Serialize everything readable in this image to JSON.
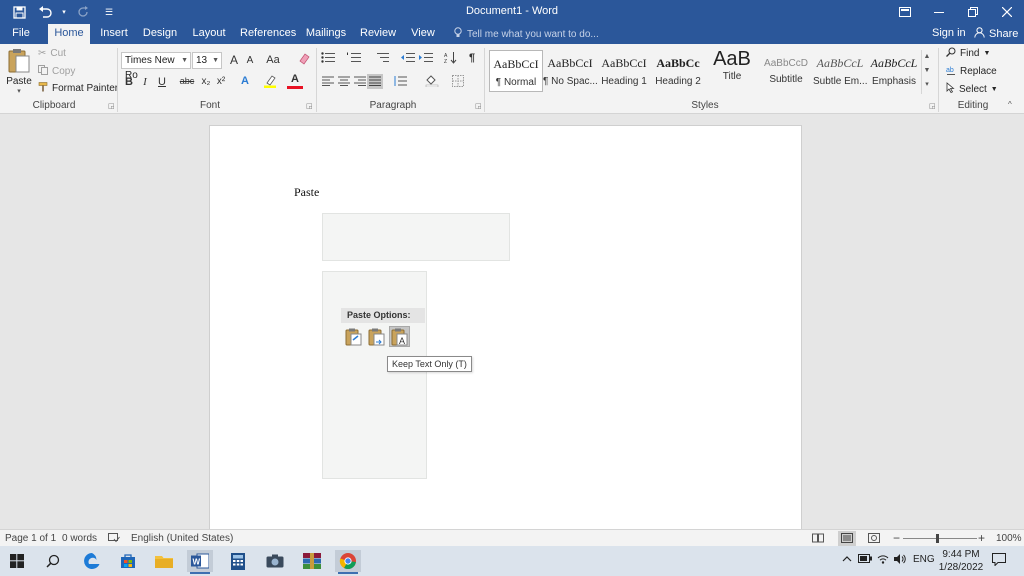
{
  "window": {
    "title": "Document1 - Word",
    "minimize_icon": "minimize-icon",
    "restore_icon": "restore-icon",
    "close_icon": "close-icon"
  },
  "tabs": [
    "File",
    "Home",
    "Insert",
    "Design",
    "Layout",
    "References",
    "Mailings",
    "Review",
    "View"
  ],
  "active_tab": "Home",
  "tell_me": "Tell me what you want to do...",
  "sign_in": "Sign in",
  "share": "Share",
  "clipboard": {
    "paste": "Paste",
    "cut": "Cut",
    "copy": "Copy",
    "format_painter": "Format Painter",
    "group": "Clipboard"
  },
  "font": {
    "name": "Times New Ro",
    "size": "13",
    "group": "Font",
    "grow": "A",
    "shrink": "A",
    "case": "Aa",
    "bold": "B",
    "italic": "I",
    "underline": "U",
    "strike": "abc",
    "subscript": "x₂",
    "superscript": "x²",
    "effects": "A",
    "font_color": "A"
  },
  "paragraph": {
    "group": "Paragraph",
    "pilcrow": "¶"
  },
  "styles": {
    "group": "Styles",
    "items": [
      {
        "preview": "AaBbCcI",
        "name": "¶ Normal"
      },
      {
        "preview": "AaBbCcI",
        "name": "¶ No Spac..."
      },
      {
        "preview": "AaBbCcI",
        "name": "Heading 1"
      },
      {
        "preview": "AaBbCc",
        "name": "Heading 2"
      },
      {
        "preview": "AaB",
        "name": "Title"
      },
      {
        "preview": "AaBbCcD",
        "name": "Subtitle"
      },
      {
        "preview": "AaBbCcL",
        "name": "Subtle Em..."
      },
      {
        "preview": "AaBbCcL",
        "name": "Emphasis"
      }
    ]
  },
  "editing": {
    "find": "Find",
    "replace": "Replace",
    "select": "Select",
    "group": "Editing"
  },
  "document": {
    "text": "Paste",
    "paste_options_label": "Paste Options:",
    "tooltip": "Keep Text Only (T)"
  },
  "status": {
    "page": "Page 1 of 1",
    "words": "0 words",
    "language": "English (United States)",
    "zoom": "100%",
    "zoom_minus": "−",
    "zoom_plus": "+"
  },
  "taskbar": {
    "language": "ENG",
    "time": "9:44 PM",
    "date": "1/28/2022"
  },
  "colors": {
    "word_blue": "#2b579a",
    "highlight_yellow": "#ffff00",
    "font_red": "#e81123"
  }
}
